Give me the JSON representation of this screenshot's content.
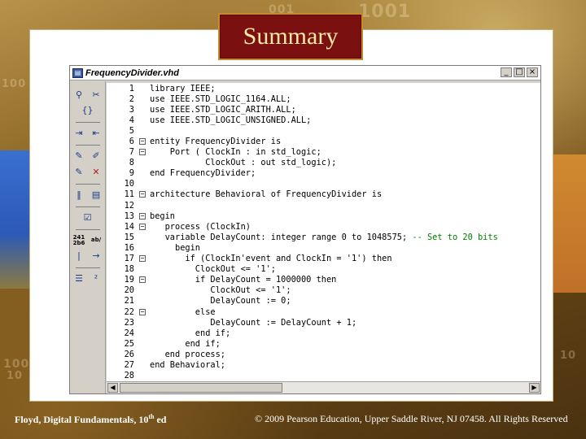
{
  "slide": {
    "title": "Summary",
    "footer_left_prefix": "Floyd, Digital Fundamentals, 10",
    "footer_left_sup": "th",
    "footer_left_suffix": " ed",
    "footer_right": "© 2009 Pearson Education, Upper Saddle River, NJ 07458. All Rights Reserved"
  },
  "background_numbers": [
    "1001",
    "1001",
    "100",
    "001",
    "1001",
    "10",
    "10"
  ],
  "window": {
    "title": "FrequencyDivider.vhd",
    "minimize": "_",
    "maximize": "□",
    "close": "×"
  },
  "toolbar": {
    "rows": [
      [
        "binoculars-icon",
        "scissors-icon"
      ],
      [
        "braces-icon"
      ],
      [
        "indent-icon",
        "outdent-icon"
      ],
      [
        "pin-icon",
        "unpin-icon"
      ],
      [
        "mark-icon",
        "unmark-icon"
      ],
      [
        "bookmark-icon",
        "bookmark-list-icon"
      ],
      [
        "check-icon"
      ],
      [
        "binary-icon",
        "hex-icon"
      ],
      [
        "cursor-icon",
        "arrow-right-icon"
      ],
      [
        "list-icon",
        "number-icon"
      ]
    ],
    "binary_label": "241\n2b6",
    "hex_label": "ab/"
  },
  "code": {
    "lines": [
      {
        "n": "1",
        "fold": "",
        "text": "library IEEE;"
      },
      {
        "n": "2",
        "fold": "",
        "text": "use IEEE.STD_LOGIC_1164.ALL;"
      },
      {
        "n": "3",
        "fold": "",
        "text": "use IEEE.STD_LOGIC_ARITH.ALL;"
      },
      {
        "n": "4",
        "fold": "",
        "text": "use IEEE.STD_LOGIC_UNSIGNED.ALL;"
      },
      {
        "n": "5",
        "fold": "",
        "text": ""
      },
      {
        "n": "6",
        "fold": "−",
        "text": "entity FrequencyDivider is"
      },
      {
        "n": "7",
        "fold": "−",
        "text": "    Port ( ClockIn : in std_logic;"
      },
      {
        "n": "8",
        "fold": "",
        "text": "           ClockOut : out std_logic);"
      },
      {
        "n": "9",
        "fold": "",
        "text": "end FrequencyDivider;"
      },
      {
        "n": "10",
        "fold": "",
        "text": ""
      },
      {
        "n": "11",
        "fold": "−",
        "text": "architecture Behavioral of FrequencyDivider is"
      },
      {
        "n": "12",
        "fold": "",
        "text": ""
      },
      {
        "n": "13",
        "fold": "−",
        "text": "begin"
      },
      {
        "n": "14",
        "fold": "−",
        "text": "   process (ClockIn)"
      },
      {
        "n": "15",
        "fold": "",
        "text": "   variable DelayCount: integer range 0 to 1048575; ",
        "comment": "-- Set to 20 bits"
      },
      {
        "n": "16",
        "fold": "",
        "text": "     begin"
      },
      {
        "n": "17",
        "fold": "−",
        "text": "       if (ClockIn'event and ClockIn = '1') then"
      },
      {
        "n": "18",
        "fold": "",
        "text": "         ClockOut <= '1';"
      },
      {
        "n": "19",
        "fold": "−",
        "text": "         if DelayCount = 1000000 then"
      },
      {
        "n": "20",
        "fold": "",
        "text": "            ClockOut <= '1';"
      },
      {
        "n": "21",
        "fold": "",
        "text": "            DelayCount := 0;"
      },
      {
        "n": "22",
        "fold": "−",
        "text": "         else"
      },
      {
        "n": "23",
        "fold": "",
        "text": "            DelayCount := DelayCount + 1;"
      },
      {
        "n": "24",
        "fold": "",
        "text": "         end if;"
      },
      {
        "n": "25",
        "fold": "",
        "text": "       end if;"
      },
      {
        "n": "26",
        "fold": "",
        "text": "   end process;"
      },
      {
        "n": "27",
        "fold": "",
        "text": "end Behavioral;"
      },
      {
        "n": "28",
        "fold": "",
        "text": ""
      }
    ]
  },
  "colors": {
    "title_bg": "#7a1010",
    "title_text": "#ffe9a8",
    "comment": "#008000"
  }
}
